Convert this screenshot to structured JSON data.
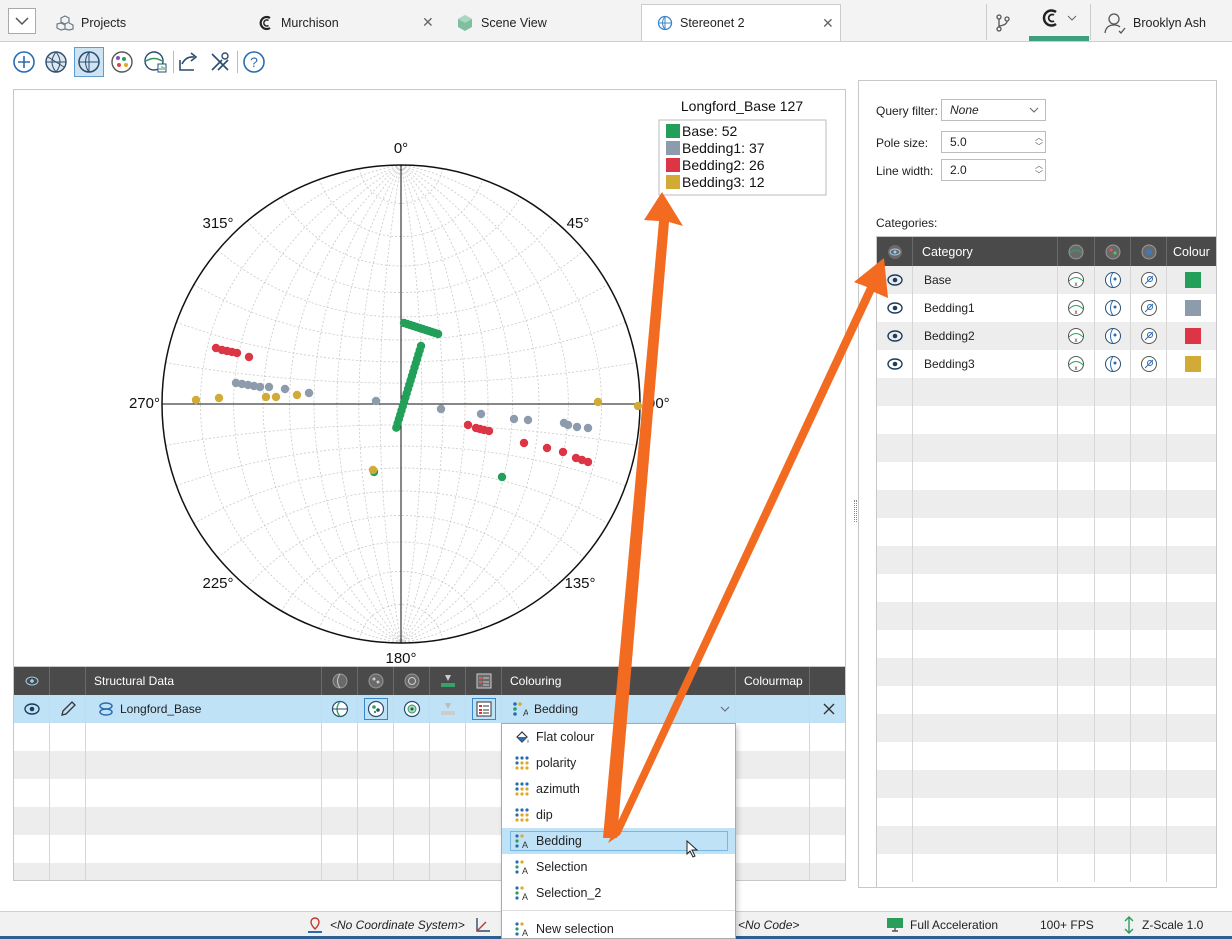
{
  "tabs": {
    "projects": "Projects",
    "murchison": "Murchison",
    "scene_view": "Scene View",
    "stereonet": "Stereonet 2",
    "user": "Brooklyn Ash"
  },
  "stereonet": {
    "title": "Longford_Base 127",
    "legend": [
      {
        "label": "Base: 52",
        "color": "#22a05a"
      },
      {
        "label": "Bedding1: 37",
        "color": "#8c9cad"
      },
      {
        "label": "Bedding2: 26",
        "color": "#dc3545"
      },
      {
        "label": "Bedding3: 12",
        "color": "#d1ab35"
      }
    ],
    "azimuth_labels": {
      "n": "0°",
      "ne": "45°",
      "e": "90°",
      "se": "135°",
      "s": "180°",
      "sw": "225°",
      "w": "270°",
      "nw": "315°"
    }
  },
  "table": {
    "headers": {
      "structural_data": "Structural Data",
      "colouring": "Colouring",
      "colourmap": "Colourmap"
    },
    "row": {
      "name": "Longford_Base",
      "colouring": "Bedding"
    }
  },
  "dropdown": {
    "items": [
      "Flat colour",
      "polarity",
      "azimuth",
      "dip",
      "Bedding",
      "Selection",
      "Selection_2"
    ],
    "new_selection": "New selection"
  },
  "properties": {
    "query_filter_label": "Query filter:",
    "query_filter_value": "None",
    "pole_size_label": "Pole size:",
    "pole_size_value": "5.0",
    "line_width_label": "Line width:",
    "line_width_value": "2.0",
    "categories_label": "Categories:",
    "cat_headers": {
      "category": "Category",
      "colour": "Colour"
    },
    "categories": [
      {
        "name": "Base",
        "color": "#22a05a"
      },
      {
        "name": "Bedding1",
        "color": "#8c9cad"
      },
      {
        "name": "Bedding2",
        "color": "#dc3545"
      },
      {
        "name": "Bedding3",
        "color": "#d1ab35"
      }
    ]
  },
  "status": {
    "coord": "<No Coordinate System>",
    "code": "<No Code>",
    "accel": "Full Acceleration",
    "fps": "100+ FPS",
    "zscale": "Z-Scale 1.0"
  }
}
